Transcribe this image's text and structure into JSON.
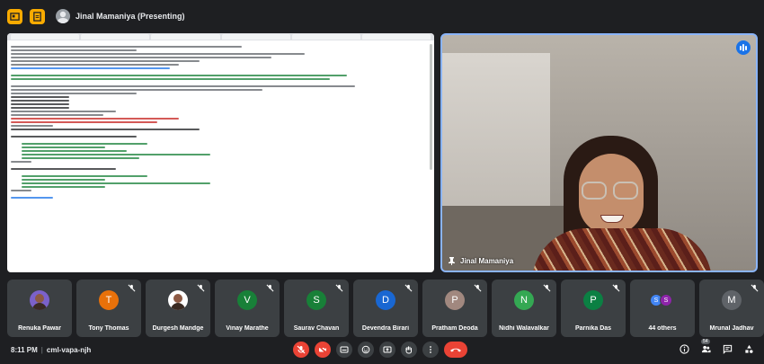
{
  "topbar": {
    "presenter_name": "Jinal Mamaniya (Presenting)"
  },
  "main_video": {
    "name": "Jinal Mamaniya"
  },
  "participants": [
    {
      "name": "Renuka Pawar",
      "initial": "",
      "color": "#7b61c9",
      "muted": false,
      "photo": true
    },
    {
      "name": "Tony Thomas",
      "initial": "T",
      "color": "#e8710a",
      "muted": true,
      "photo": false
    },
    {
      "name": "Durgesh Mandge",
      "initial": "",
      "color": "#ffffff",
      "muted": true,
      "photo": true
    },
    {
      "name": "Vinay Marathe",
      "initial": "V",
      "color": "#188038",
      "muted": true,
      "photo": false
    },
    {
      "name": "Saurav Chavan",
      "initial": "S",
      "color": "#188038",
      "muted": true,
      "photo": false
    },
    {
      "name": "Devendra Birari",
      "initial": "D",
      "color": "#1967d2",
      "muted": true,
      "photo": false
    },
    {
      "name": "Pratham Deoda",
      "initial": "P",
      "color": "#a1887f",
      "muted": true,
      "photo": false
    },
    {
      "name": "Nidhi Walavalkar",
      "initial": "N",
      "color": "#34a853",
      "muted": true,
      "photo": false
    },
    {
      "name": "Parnika Das",
      "initial": "P",
      "color": "#0b8043",
      "muted": true,
      "photo": false
    }
  ],
  "others": {
    "label": "44 others",
    "initials": [
      "S",
      "S"
    ],
    "colors": [
      "#4285f4",
      "#8e24aa"
    ]
  },
  "last_tile": {
    "name": "Mrunal Jadhav",
    "initial": "M",
    "color": "#5f6368"
  },
  "bottom": {
    "time": "8:11 PM",
    "meeting_code": "cml-vapa-njh",
    "people_count": "54"
  }
}
